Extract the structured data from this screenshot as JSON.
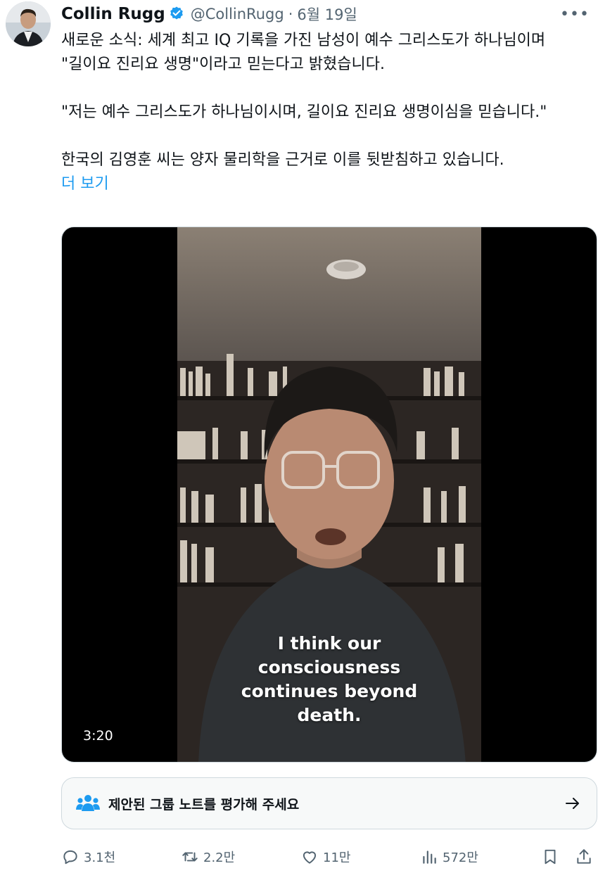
{
  "author": {
    "name": "Collin Rugg",
    "handle": "@CollinRugg",
    "separator": "·",
    "date": "6월 19일"
  },
  "tweet": {
    "paragraphs": [
      "새로운 소식: 세계 최고 IQ 기록을 가진 남성이 예수 그리스도가 하나님이며 \"길이요 진리요 생명\"이라고 믿는다고 밝혔습니다.",
      "\"저는 예수 그리스도가 하나님이시며, 길이요 진리요 생명이심을 믿습니다.\"",
      "한국의 김영훈 씨는 양자 물리학을 근거로 이를 뒷받침하고 있습니다."
    ],
    "show_more": "더 보기"
  },
  "video": {
    "caption_lines": [
      "I think our",
      "consciousness",
      "continues beyond",
      "death."
    ],
    "duration": "3:20"
  },
  "community_note": {
    "text": "제안된 그룹 노트를 평가해 주세요"
  },
  "actions": {
    "replies": "3.1천",
    "reposts": "2.2만",
    "likes": "11만",
    "views": "572만"
  },
  "colors": {
    "accent": "#1d9bf0",
    "repost_green": "#00ba7c",
    "secondary_text": "#536471"
  }
}
